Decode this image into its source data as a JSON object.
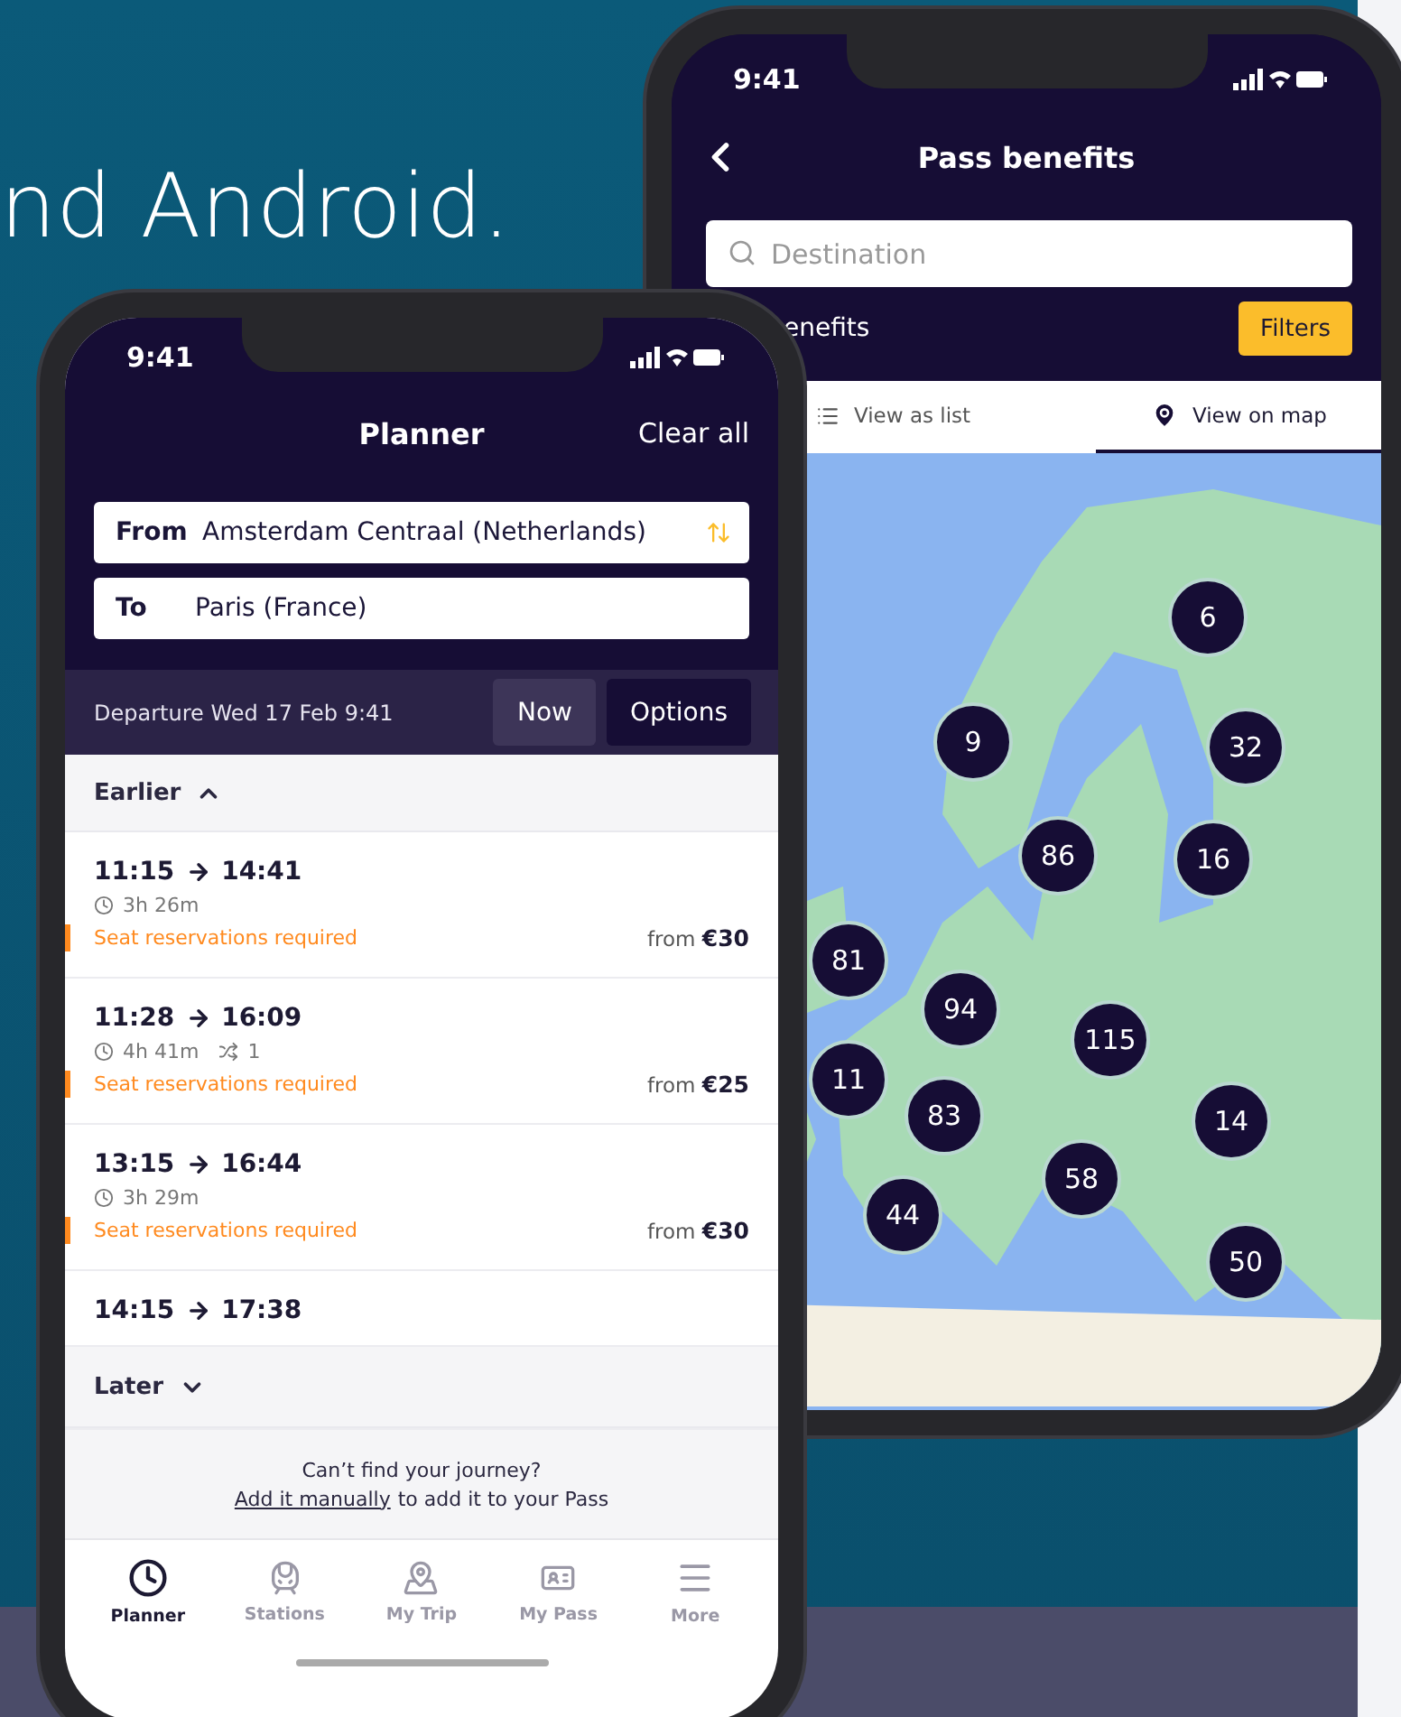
{
  "headline": "nd Android.",
  "back_phone": {
    "status_time": "9:41",
    "title": "Pass benefits",
    "search": {
      "placeholder": "Destination"
    },
    "filter_label": "enefits",
    "filters_button": "Filters",
    "tabs": [
      {
        "label": "View as list",
        "selected": false
      },
      {
        "label": "View on map",
        "selected": true
      }
    ],
    "map_clusters": [
      {
        "count": "6"
      },
      {
        "count": "9"
      },
      {
        "count": "32"
      },
      {
        "count": "86"
      },
      {
        "count": "16"
      },
      {
        "count": "81"
      },
      {
        "count": "94"
      },
      {
        "count": "115"
      },
      {
        "count": "11"
      },
      {
        "count": "83"
      },
      {
        "count": "14"
      },
      {
        "count": "58"
      },
      {
        "count": "44"
      },
      {
        "count": "50"
      }
    ]
  },
  "front_phone": {
    "status_time": "9:41",
    "title": "Planner",
    "action": "Clear all",
    "from": {
      "label": "From",
      "value": "Amsterdam Centraal  (Netherlands)"
    },
    "to": {
      "label": "To",
      "value": "Paris (France)"
    },
    "departure": "Departure Wed 17 Feb 9:41",
    "now_button": "Now",
    "options_button": "Options",
    "earlier": "Earlier",
    "later": "Later",
    "journeys": [
      {
        "depart": "11:15",
        "arrive": "14:41",
        "duration": "3h 26m",
        "warning": "Seat reservations required",
        "price": "from **€30**"
      },
      {
        "depart": "11:28",
        "arrive": "16:09",
        "duration": "4h 41m",
        "changes": "1",
        "warning": "Seat reservations required",
        "price": "from **€25**"
      },
      {
        "depart": "13:15",
        "arrive": "16:44",
        "duration": "3h 29m",
        "warning": "Seat reservations required",
        "price": "from **€30**"
      },
      {
        "depart": "14:15",
        "arrive": "17:38"
      }
    ],
    "footer": {
      "question": "Can’t find your journey?",
      "link": "Add it manually",
      "rest": "to add it to your Pass"
    },
    "nav": [
      {
        "label": "Planner",
        "selected": true,
        "kind": "clock"
      },
      {
        "label": "Stations",
        "selected": false,
        "kind": "train"
      },
      {
        "label": "My Trip",
        "selected": false,
        "kind": "map"
      },
      {
        "label": "My Pass",
        "selected": false,
        "kind": "pass"
      },
      {
        "label": "More",
        "selected": false,
        "kind": "menu"
      }
    ]
  }
}
